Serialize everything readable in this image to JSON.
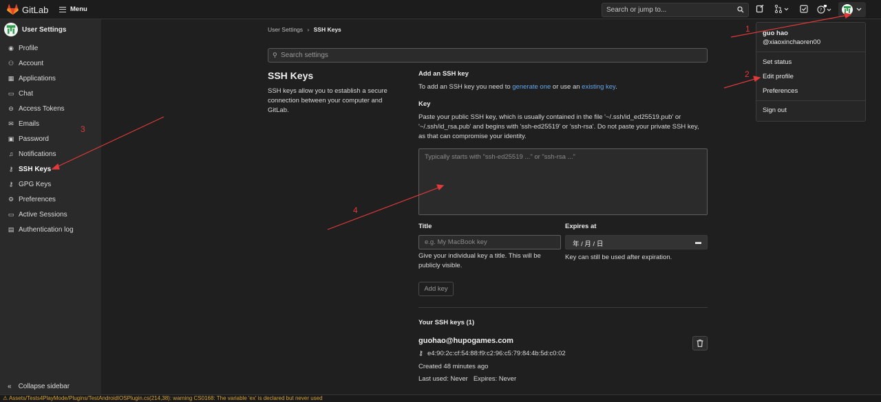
{
  "topbar": {
    "brand": "GitLab",
    "menu_label": "Menu",
    "search_placeholder": "Search or jump to..."
  },
  "sidebar": {
    "title": "User Settings",
    "items": [
      {
        "label": "Profile",
        "icon": "profile-icon"
      },
      {
        "label": "Account",
        "icon": "account-icon"
      },
      {
        "label": "Applications",
        "icon": "applications-icon"
      },
      {
        "label": "Chat",
        "icon": "chat-icon"
      },
      {
        "label": "Access Tokens",
        "icon": "token-icon"
      },
      {
        "label": "Emails",
        "icon": "mail-icon"
      },
      {
        "label": "Password",
        "icon": "lock-icon"
      },
      {
        "label": "Notifications",
        "icon": "bell-icon"
      },
      {
        "label": "SSH Keys",
        "icon": "key-icon",
        "active": true
      },
      {
        "label": "GPG Keys",
        "icon": "key-icon"
      },
      {
        "label": "Preferences",
        "icon": "preferences-icon"
      },
      {
        "label": "Active Sessions",
        "icon": "monitor-icon"
      },
      {
        "label": "Authentication log",
        "icon": "log-icon"
      }
    ],
    "collapse_label": "Collapse sidebar"
  },
  "breadcrumb": {
    "parent": "User Settings",
    "current": "SSH Keys"
  },
  "settings_search_placeholder": "Search settings",
  "page": {
    "title": "SSH Keys",
    "description": "SSH keys allow you to establish a secure connection between your computer and GitLab."
  },
  "add_key": {
    "heading": "Add an SSH key",
    "intro_before": "To add an SSH key you need to ",
    "link1": "generate one",
    "intro_mid": " or use an ",
    "link2": "existing key",
    "intro_after": ".",
    "key_label": "Key",
    "key_help": "Paste your public SSH key, which is usually contained in the file '~/.ssh/id_ed25519.pub' or '~/.ssh/id_rsa.pub' and begins with 'ssh-ed25519' or 'ssh-rsa'. Do not paste your private SSH key, as that can compromise your identity.",
    "key_placeholder": "Typically starts with \"ssh-ed25519 ...\" or \"ssh-rsa ...\"",
    "title_label": "Title",
    "title_placeholder": "e.g. My MacBook key",
    "title_help": "Give your individual key a title. This will be publicly visible.",
    "expires_label": "Expires at",
    "expires_value": "年 / 月 / 日",
    "expires_help": "Key can still be used after expiration.",
    "add_button": "Add key"
  },
  "your_keys": {
    "heading": "Your SSH keys (1)",
    "keys": [
      {
        "title": "guohao@hupogames.com",
        "fingerprint": "e4:90:2c:cf:54:88:f9:c2:96:c5:79:84:4b:5d:c0:02",
        "created": "Created 48 minutes ago",
        "last_used": "Last used: Never",
        "expires": "Expires: Never"
      }
    ]
  },
  "user_menu": {
    "name": "guo hao",
    "handle": "@xiaoxinchaoren00",
    "items": [
      "Set status",
      "Edit profile",
      "Preferences",
      "Sign out"
    ]
  },
  "annotations": [
    "1",
    "2",
    "3",
    "4"
  ],
  "status_bar": {
    "warning": "Assets/Tests4PlayMode/Plugins/TestAndroidIOSPlugin.cs(214,38): warning CS0168: The variable 'ex' is declared but never used"
  },
  "colors": {
    "accent_link": "#63a6e9",
    "annotation_red": "#e03a3a",
    "brand_orange": "#fc6d26"
  }
}
